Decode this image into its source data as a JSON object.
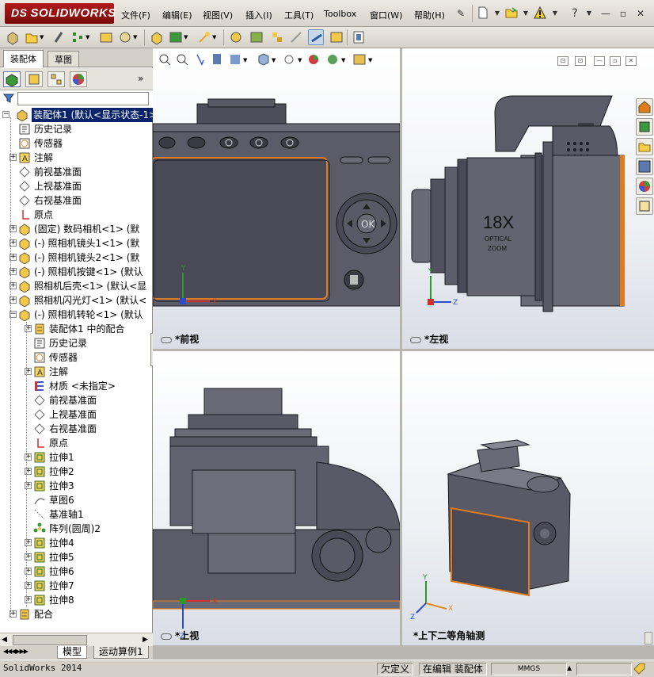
{
  "app": {
    "brand": "SOLIDWORKS",
    "brand_prefix": "DS"
  },
  "menu": {
    "items": [
      "文件(F)",
      "编辑(E)",
      "视图(V)",
      "插入(I)",
      "工具(T)",
      "Toolbox",
      "窗口(W)",
      "帮助(H)"
    ]
  },
  "panel": {
    "tabs": [
      "装配体",
      "草图"
    ],
    "bottom_tabs": [
      "模型",
      "运动算例1"
    ]
  },
  "tree": {
    "rows": [
      {
        "label": "装配体1 (默认<显示状态-1>)",
        "indent": 0,
        "icon": "assembly-icon",
        "expander": false,
        "selected": true
      },
      {
        "label": "历史记录",
        "indent": 1,
        "icon": "history-icon",
        "expander": false
      },
      {
        "label": "传感器",
        "indent": 1,
        "icon": "sensor-icon",
        "expander": false
      },
      {
        "label": "注解",
        "indent": 1,
        "icon": "annotation-icon",
        "expander": true
      },
      {
        "label": "前视基准面",
        "indent": 1,
        "icon": "plane-icon",
        "expander": false
      },
      {
        "label": "上视基准面",
        "indent": 1,
        "icon": "plane-icon",
        "expander": false
      },
      {
        "label": "右视基准面",
        "indent": 1,
        "icon": "plane-icon",
        "expander": false
      },
      {
        "label": "原点",
        "indent": 1,
        "icon": "origin-icon",
        "expander": false
      },
      {
        "label": "(固定) 数码相机<1> (默",
        "indent": 1,
        "icon": "part-icon",
        "expander": true
      },
      {
        "label": "(-) 照相机镜头1<1> (默",
        "indent": 1,
        "icon": "part-icon",
        "expander": true
      },
      {
        "label": "(-) 照相机镜头2<1> (默",
        "indent": 1,
        "icon": "part-icon",
        "expander": true
      },
      {
        "label": "(-) 照相机按键<1> (默认",
        "indent": 1,
        "icon": "part-icon",
        "expander": true
      },
      {
        "label": "照相机后壳<1> (默认<显",
        "indent": 1,
        "icon": "part-icon",
        "expander": true
      },
      {
        "label": "照相机闪光灯<1> (默认<",
        "indent": 1,
        "icon": "part-icon",
        "expander": true
      },
      {
        "label": "(-) 照相机转轮<1> (默认",
        "indent": 1,
        "icon": "part-icon",
        "expander": true,
        "expanded": true
      },
      {
        "label": "装配体1 中的配合",
        "indent": 2,
        "icon": "mates-icon",
        "expander": true
      },
      {
        "label": "历史记录",
        "indent": 2,
        "icon": "history-icon",
        "expander": false
      },
      {
        "label": "传感器",
        "indent": 2,
        "icon": "sensor-icon",
        "expander": false
      },
      {
        "label": "注解",
        "indent": 2,
        "icon": "annotation-icon",
        "expander": true
      },
      {
        "label": "材质 <未指定>",
        "indent": 2,
        "icon": "material-icon",
        "expander": false
      },
      {
        "label": "前视基准面",
        "indent": 2,
        "icon": "plane-icon",
        "expander": false
      },
      {
        "label": "上视基准面",
        "indent": 2,
        "icon": "plane-icon",
        "expander": false
      },
      {
        "label": "右视基准面",
        "indent": 2,
        "icon": "plane-icon",
        "expander": false
      },
      {
        "label": "原点",
        "indent": 2,
        "icon": "origin-icon",
        "expander": false
      },
      {
        "label": "拉伸1",
        "indent": 2,
        "icon": "extrude-icon",
        "expander": true
      },
      {
        "label": "拉伸2",
        "indent": 2,
        "icon": "extrude-icon",
        "expander": true
      },
      {
        "label": "拉伸3",
        "indent": 2,
        "icon": "extrude-icon",
        "expander": true
      },
      {
        "label": "草图6",
        "indent": 2,
        "icon": "sketch-icon",
        "expander": false
      },
      {
        "label": "基准轴1",
        "indent": 2,
        "icon": "axis-icon",
        "expander": false
      },
      {
        "label": "阵列(圆周)2",
        "indent": 2,
        "icon": "pattern-icon",
        "expander": false
      },
      {
        "label": "拉伸4",
        "indent": 2,
        "icon": "extrude-icon",
        "expander": true
      },
      {
        "label": "拉伸5",
        "indent": 2,
        "icon": "extrude-icon",
        "expander": true
      },
      {
        "label": "拉伸6",
        "indent": 2,
        "icon": "extrude-icon",
        "expander": true
      },
      {
        "label": "拉伸7",
        "indent": 2,
        "icon": "extrude-icon",
        "expander": true
      },
      {
        "label": "拉伸8",
        "indent": 2,
        "icon": "extrude-icon",
        "expander": true
      },
      {
        "label": "配合",
        "indent": 1,
        "icon": "mates-icon",
        "expander": true
      }
    ]
  },
  "viewports": {
    "front": "*前视",
    "left": "*左视",
    "top": "*上视",
    "iso": "*上下二等角轴测"
  },
  "camera_text": {
    "zoom": "18X",
    "optical": "OPTICAL",
    "zoom_word": "ZOOM"
  },
  "status": {
    "app_version": "SolidWorks 2014",
    "under_defined": "欠定义",
    "editing": "在编辑 装配体",
    "units": "MMGS"
  },
  "colors": {
    "selection": "#0a246a",
    "body": "#5c5c68",
    "screen": "#e07a1a"
  }
}
